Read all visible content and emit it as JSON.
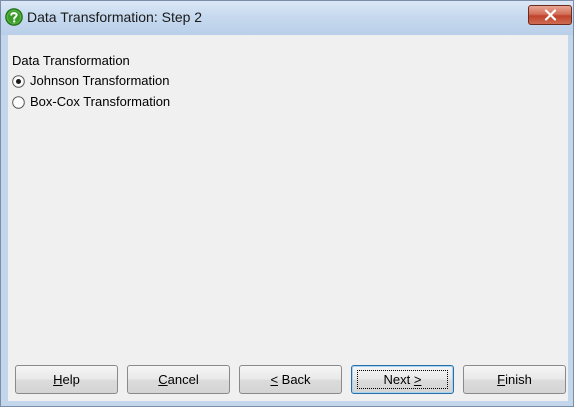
{
  "window": {
    "title": "Data Transformation: Step 2",
    "icon": "help-question-icon",
    "close_icon": "close-icon"
  },
  "group": {
    "label": "Data Transformation",
    "options": [
      {
        "label": "Johnson Transformation",
        "selected": true
      },
      {
        "label": "Box-Cox Transformation",
        "selected": false
      }
    ]
  },
  "buttons": {
    "help": {
      "mnemonic": "H",
      "rest": "elp"
    },
    "cancel": {
      "mnemonic": "C",
      "rest": "ancel"
    },
    "back": {
      "prefix": "",
      "mnemonic": "<",
      "rest": " Back"
    },
    "next": {
      "prefix": "Next ",
      "mnemonic": ">",
      "rest": ""
    },
    "finish": {
      "mnemonic": "F",
      "rest": "inish"
    }
  },
  "colors": {
    "title_icon_green": "#3a9a2a",
    "close_button_red": "#c0432b",
    "dialog_background": "#f0f0f0"
  }
}
